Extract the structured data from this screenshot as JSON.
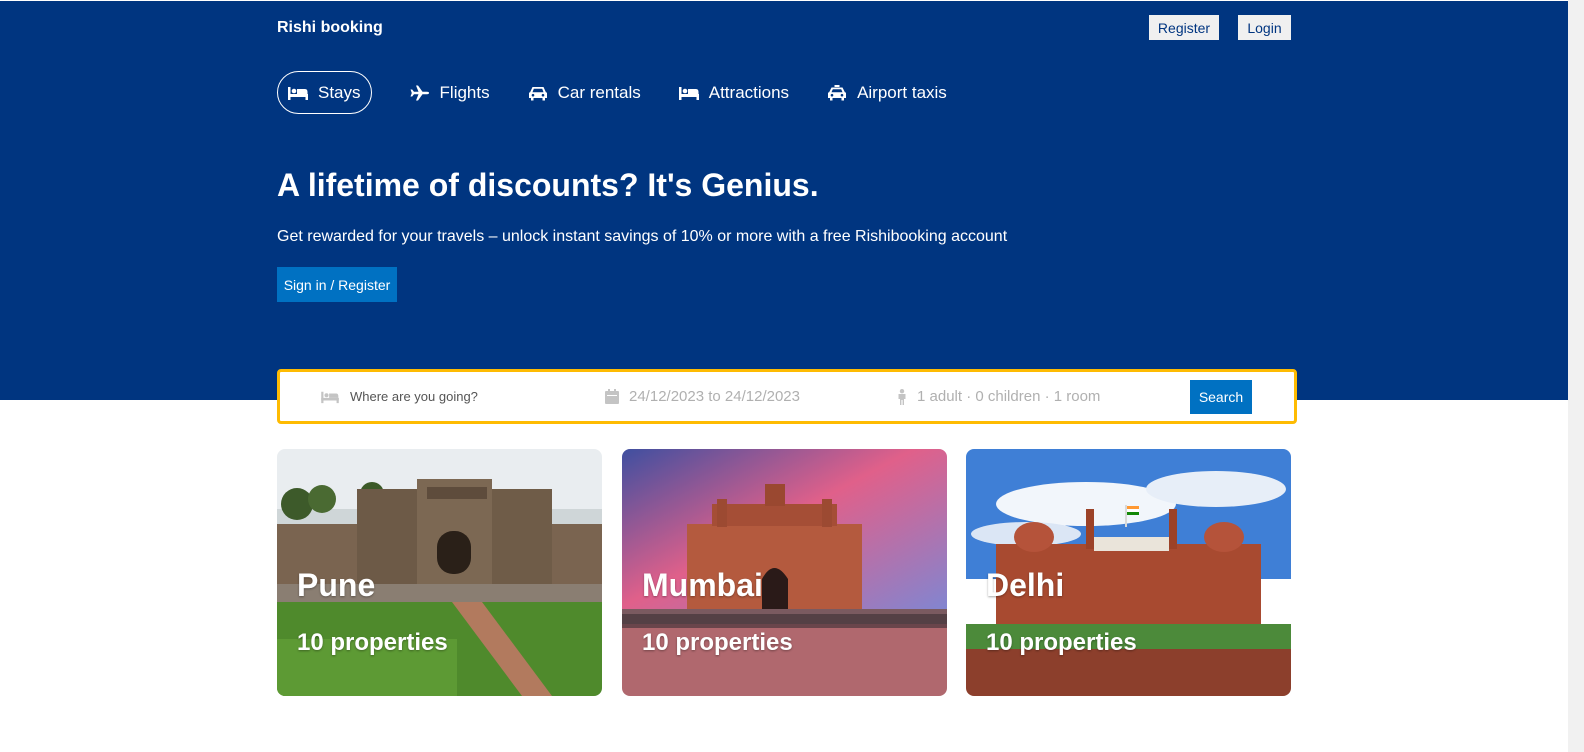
{
  "header": {
    "logo": "Rishi booking",
    "register_label": "Register",
    "login_label": "Login"
  },
  "nav": {
    "items": [
      {
        "label": "Stays",
        "icon": "bed-icon",
        "active": true
      },
      {
        "label": "Flights",
        "icon": "plane-icon"
      },
      {
        "label": "Car rentals",
        "icon": "car-icon"
      },
      {
        "label": "Attractions",
        "icon": "bed-icon"
      },
      {
        "label": "Airport taxis",
        "icon": "taxi-icon"
      }
    ]
  },
  "hero": {
    "title": "A lifetime of discounts? It's Genius.",
    "subtitle": "Get rewarded for your travels – unlock instant savings of 10% or more with a free Rishibooking account",
    "button_label": "Sign in / Register"
  },
  "search": {
    "destination_placeholder": "Where are you going?",
    "dates": "24/12/2023 to 24/12/2023",
    "options": "1 adult · 0 children · 1 room",
    "button_label": "Search"
  },
  "cards": [
    {
      "city": "Pune",
      "properties": "10 properties"
    },
    {
      "city": "Mumbai",
      "properties": "10 properties"
    },
    {
      "city": "Delhi",
      "properties": "10 properties"
    }
  ],
  "colors": {
    "brand_blue": "#003580",
    "accent_blue": "#0071c2",
    "search_border": "#febb02"
  }
}
